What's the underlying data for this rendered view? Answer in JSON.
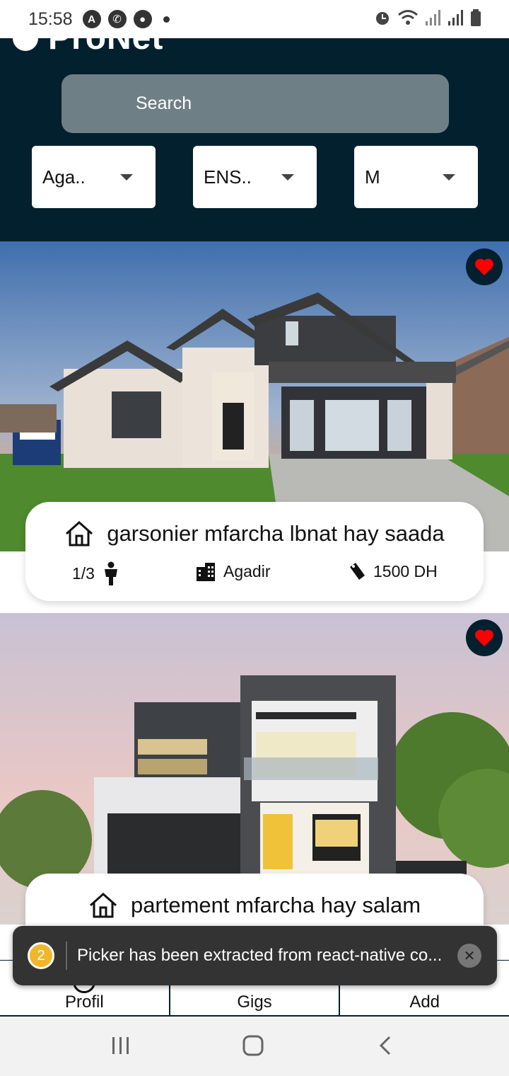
{
  "status_bar": {
    "time": "15:58",
    "left_icons": [
      "a-icon",
      "whatsapp-icon",
      "account-icon"
    ],
    "right_icons": [
      "alarm-icon",
      "wifi-icon",
      "signal-icon",
      "signal-icon",
      "battery-icon"
    ]
  },
  "header": {
    "app_name": "ProNet",
    "search_placeholder": "Search",
    "filters": [
      {
        "value": "Aga.."
      },
      {
        "value": "ENS.."
      },
      {
        "value": "M"
      }
    ]
  },
  "listings": [
    {
      "title": "garsonier mfarcha lbnat hay saada",
      "occupancy": "1/3",
      "city": "Agadir",
      "price": "1500 DH",
      "favorited": true
    },
    {
      "title": "partement mfarcha hay salam",
      "favorited": true
    }
  ],
  "tabs": [
    {
      "label": "Profil"
    },
    {
      "label": "Gigs"
    },
    {
      "label": "Add"
    }
  ],
  "toast": {
    "count": "2",
    "message": "Picker has been extracted from react-native co..."
  },
  "colors": {
    "header_bg": "#03202f",
    "search_bg": "#6e7f86",
    "heart": "#ff0000",
    "toast_bg": "#333333",
    "badge": "#f0b62c"
  }
}
